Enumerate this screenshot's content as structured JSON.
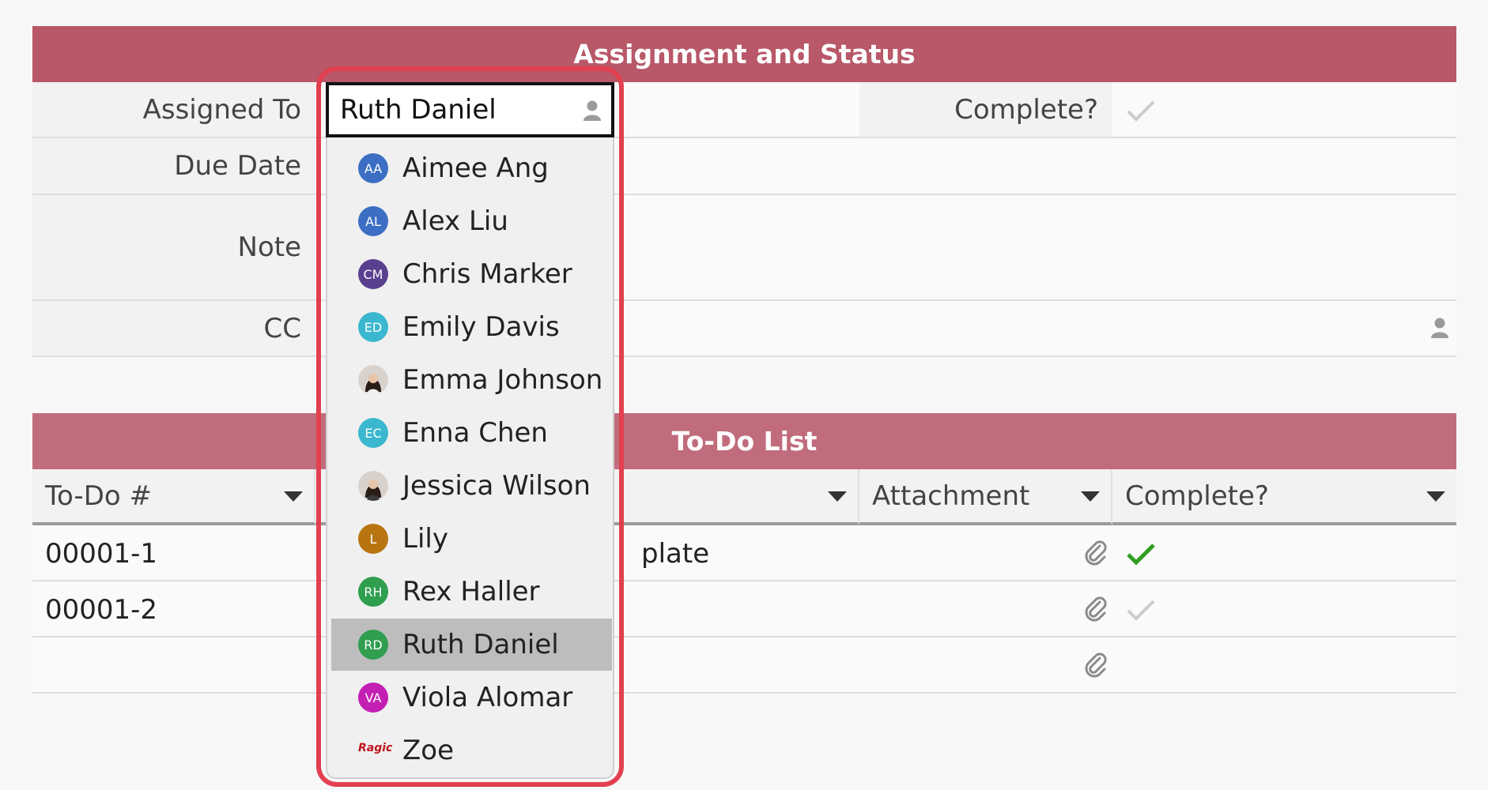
{
  "sections": {
    "assignment_title": "Assignment and Status",
    "todo_title": "To-Do List"
  },
  "fields": {
    "assigned_to_label": "Assigned To",
    "assigned_to_value": "Ruth Daniel",
    "due_date_label": "Due Date",
    "note_label": "Note",
    "cc_label": "CC",
    "complete_label": "Complete?"
  },
  "todo_table": {
    "headers": [
      "To-Do #",
      "Attachment",
      "Complete?"
    ],
    "rows": [
      {
        "number": "00001-1",
        "description_fragment": "plate",
        "complete": true
      },
      {
        "number": "00001-2",
        "description_fragment": "",
        "complete": false
      },
      {
        "number": "",
        "description_fragment": "",
        "complete": null
      }
    ]
  },
  "dropdown": {
    "selected": "Ruth Daniel",
    "options": [
      {
        "name": "Aimee Ang",
        "initials": "AA",
        "color": "#3c6fc4"
      },
      {
        "name": "Alex Liu",
        "initials": "AL",
        "color": "#3c6fc4"
      },
      {
        "name": "Chris Marker",
        "initials": "CM",
        "color": "#5b3f8f"
      },
      {
        "name": "Emily Davis",
        "initials": "ED",
        "color": "#3bb8cf"
      },
      {
        "name": "Emma Johnson",
        "initials": "",
        "color": "#c9b7aa",
        "photo": true
      },
      {
        "name": "Enna Chen",
        "initials": "EC",
        "color": "#3bb8cf"
      },
      {
        "name": "Jessica Wilson",
        "initials": "",
        "color": "#c9b7aa",
        "photo": true
      },
      {
        "name": "Lily",
        "initials": "L",
        "color": "#b87410"
      },
      {
        "name": "Rex Haller",
        "initials": "RH",
        "color": "#2f9e4f"
      },
      {
        "name": "Ruth Daniel",
        "initials": "RD",
        "color": "#2f9e4f"
      },
      {
        "name": "Viola Alomar",
        "initials": "VA",
        "color": "#c41fb3"
      },
      {
        "name": "Zoe",
        "initials": "",
        "logo": "Ragic"
      }
    ]
  },
  "colors": {
    "section_band": "#b85868",
    "highlight_outline": "#e2404f",
    "check_done": "#2f9e1f",
    "check_pending": "#cccccc"
  },
  "icons": [
    "person-icon",
    "paperclip-icon",
    "checkmark-icon",
    "caret-down-icon"
  ]
}
